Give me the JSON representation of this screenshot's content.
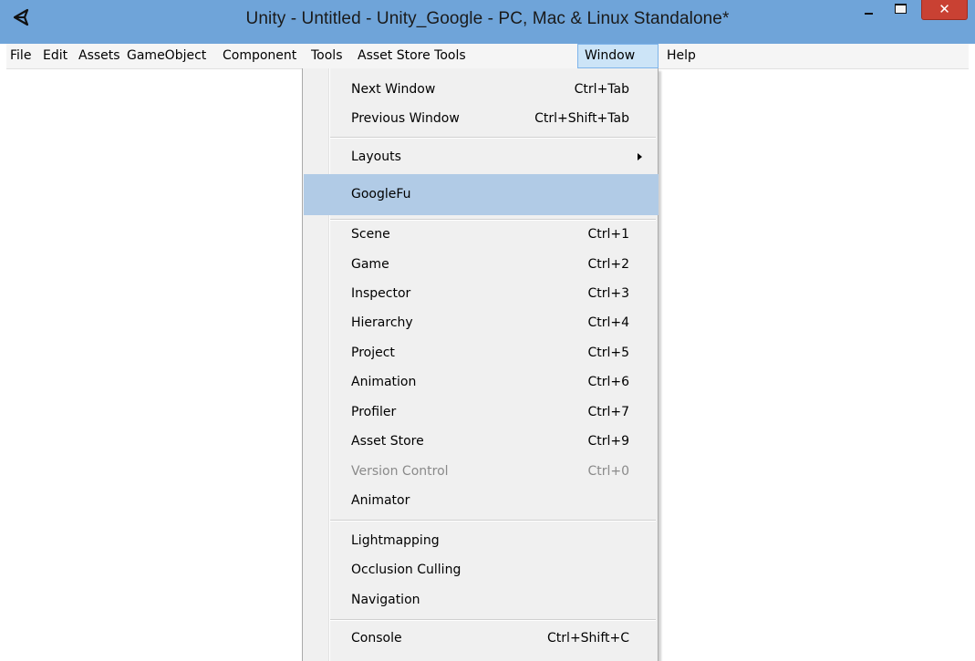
{
  "titlebar": {
    "title": "Unity - Untitled - Unity_Google - PC, Mac & Linux Standalone*",
    "app_icon": "unity-logo-icon",
    "close_glyph": "✕",
    "colors": {
      "bar": "#6fa4d9",
      "close": "#c94133"
    }
  },
  "menubar": {
    "items": [
      {
        "label": "File"
      },
      {
        "label": "Edit"
      },
      {
        "label": "Assets"
      },
      {
        "label": "GameObject"
      },
      {
        "label": "Component"
      },
      {
        "label": "Tools"
      },
      {
        "label": "Asset Store Tools"
      },
      {
        "label": "Window",
        "open": true
      },
      {
        "label": "Help"
      }
    ]
  },
  "window_menu": {
    "items": [
      {
        "label": "Next Window",
        "shortcut": "Ctrl+Tab"
      },
      {
        "label": "Previous Window",
        "shortcut": "Ctrl+Shift+Tab"
      },
      {
        "label": "Layouts",
        "submenu": true
      },
      {
        "label": "GoogleFu",
        "highlighted": true
      },
      {
        "label": "Scene",
        "shortcut": "Ctrl+1"
      },
      {
        "label": "Game",
        "shortcut": "Ctrl+2"
      },
      {
        "label": "Inspector",
        "shortcut": "Ctrl+3"
      },
      {
        "label": "Hierarchy",
        "shortcut": "Ctrl+4"
      },
      {
        "label": "Project",
        "shortcut": "Ctrl+5"
      },
      {
        "label": "Animation",
        "shortcut": "Ctrl+6"
      },
      {
        "label": "Profiler",
        "shortcut": "Ctrl+7"
      },
      {
        "label": "Asset Store",
        "shortcut": "Ctrl+9"
      },
      {
        "label": "Version Control",
        "shortcut": "Ctrl+0",
        "disabled": true
      },
      {
        "label": "Animator"
      },
      {
        "label": "Lightmapping"
      },
      {
        "label": "Occlusion Culling"
      },
      {
        "label": "Navigation"
      },
      {
        "label": "Console",
        "shortcut": "Ctrl+Shift+C"
      }
    ],
    "highlight_color": "#b1cbe6"
  }
}
